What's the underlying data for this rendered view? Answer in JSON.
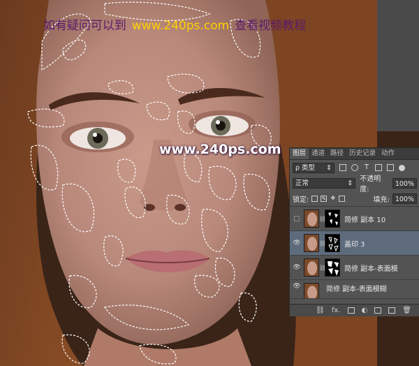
{
  "watermark": {
    "top_prefix": "如有疑问可以到",
    "top_url": "www.240ps.com",
    "top_suffix": "查看视频教程",
    "center_url": "www.240ps.com"
  },
  "layers_panel": {
    "tabs": [
      "图层",
      "通道",
      "路径",
      "历史记录",
      "动作"
    ],
    "active_tab": "图层",
    "filter_label": "ρ 类型",
    "filter_icons": [
      "image-filter-icon",
      "adjustment-filter-icon",
      "text-filter-icon",
      "shape-filter-icon",
      "smart-object-filter-icon"
    ],
    "text_filter_glyph": "T",
    "blend_mode": "正常",
    "opacity_label": "不透明度:",
    "opacity_value": "100%",
    "lock_label": "锁定:",
    "fill_label": "填充:",
    "fill_value": "100%",
    "layers": [
      {
        "name": "简修 副本 10",
        "visible": false,
        "selected": false
      },
      {
        "name": "盖印 3",
        "visible": true,
        "selected": true
      },
      {
        "name": "简修 副本-表面模",
        "visible": true,
        "selected": false
      },
      {
        "name": "简修 副本-表面模糊",
        "visible": true,
        "selected": false
      }
    ],
    "bottom_icons": [
      "link-layers-icon",
      "fx-icon",
      "add-mask-icon",
      "adjustment-layer-icon",
      "new-group-icon",
      "new-layer-icon",
      "delete-layer-icon"
    ],
    "fx_glyph": "fx."
  }
}
